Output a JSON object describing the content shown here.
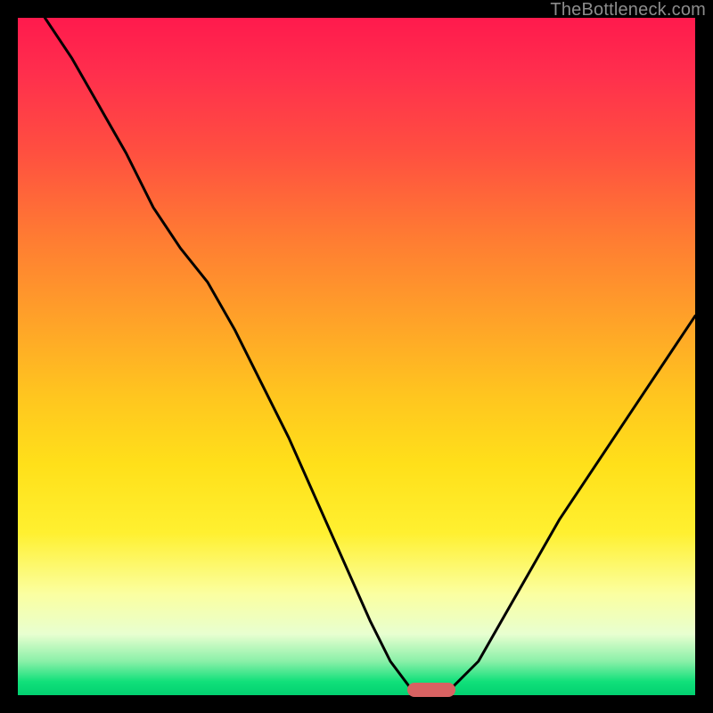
{
  "watermark": "TheBottleneck.com",
  "chart_data": {
    "type": "line",
    "title": "",
    "xlabel": "",
    "ylabel": "",
    "xlim": [
      0,
      100
    ],
    "ylim": [
      0,
      100
    ],
    "x": [
      4,
      8,
      12,
      16,
      20,
      24,
      28,
      32,
      36,
      40,
      44,
      48,
      52,
      55,
      58,
      60,
      62,
      64,
      68,
      72,
      76,
      80,
      84,
      88,
      92,
      96,
      100
    ],
    "values": [
      100,
      94,
      87,
      80,
      72,
      66,
      61,
      54,
      46,
      38,
      29,
      20,
      11,
      5,
      1,
      0,
      0,
      1,
      5,
      12,
      19,
      26,
      32,
      38,
      44,
      50,
      56
    ],
    "marker": {
      "x": 61,
      "y": 0.8
    },
    "background_gradient": {
      "top": "#ff1a4d",
      "mid": "#ffe01a",
      "bottom": "#02d070"
    }
  }
}
